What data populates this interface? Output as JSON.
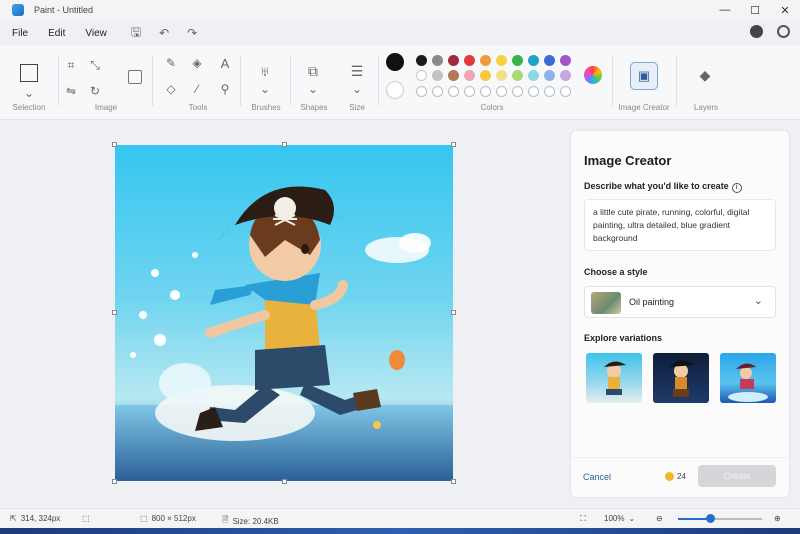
{
  "window": {
    "title": "Paint - Untitled"
  },
  "menu": [
    "File",
    "Edit",
    "View"
  ],
  "ribbon": {
    "groups": {
      "selection": "Selection",
      "image": "Image",
      "tools": "Tools",
      "brushes": "Brushes",
      "shapes": "Shapes",
      "size": "Size",
      "colors": "Colors",
      "image_creator": "Image Creator",
      "layers": "Layers"
    },
    "colors_row1": [
      "#1a1a1a",
      "#8a8a8a",
      "#a3283b",
      "#e23a3a",
      "#f39a3c",
      "#f6d23d",
      "#38b34a",
      "#1ea3c8",
      "#3d6ad6",
      "#a256c7"
    ],
    "colors_row2": [
      "#ffffff",
      "#c3c3c3",
      "#b07a56",
      "#f1a3b8",
      "#f8c840",
      "#f0e28a",
      "#a8d97a",
      "#8dd8e6",
      "#8fb3e8",
      "#c7a6e0"
    ],
    "primary_color": "#111111",
    "secondary_color": "#ffffff"
  },
  "image_creator": {
    "title": "Image Creator",
    "describe_label": "Describe what you'd like to create",
    "info_icon": "i",
    "prompt": "a little cute pirate, running, colorful, digital painting, ultra detailed, blue gradient background",
    "style_label": "Choose a style",
    "style_value": "Oil painting",
    "variations_label": "Explore variations",
    "cancel": "Cancel",
    "credits": "24",
    "create": "Create"
  },
  "status": {
    "cursor": "314, 324px",
    "dimensions": "800 × 512px",
    "size": "Size: 20.4KB",
    "zoom": "100%",
    "zoom_level": 0.38
  }
}
